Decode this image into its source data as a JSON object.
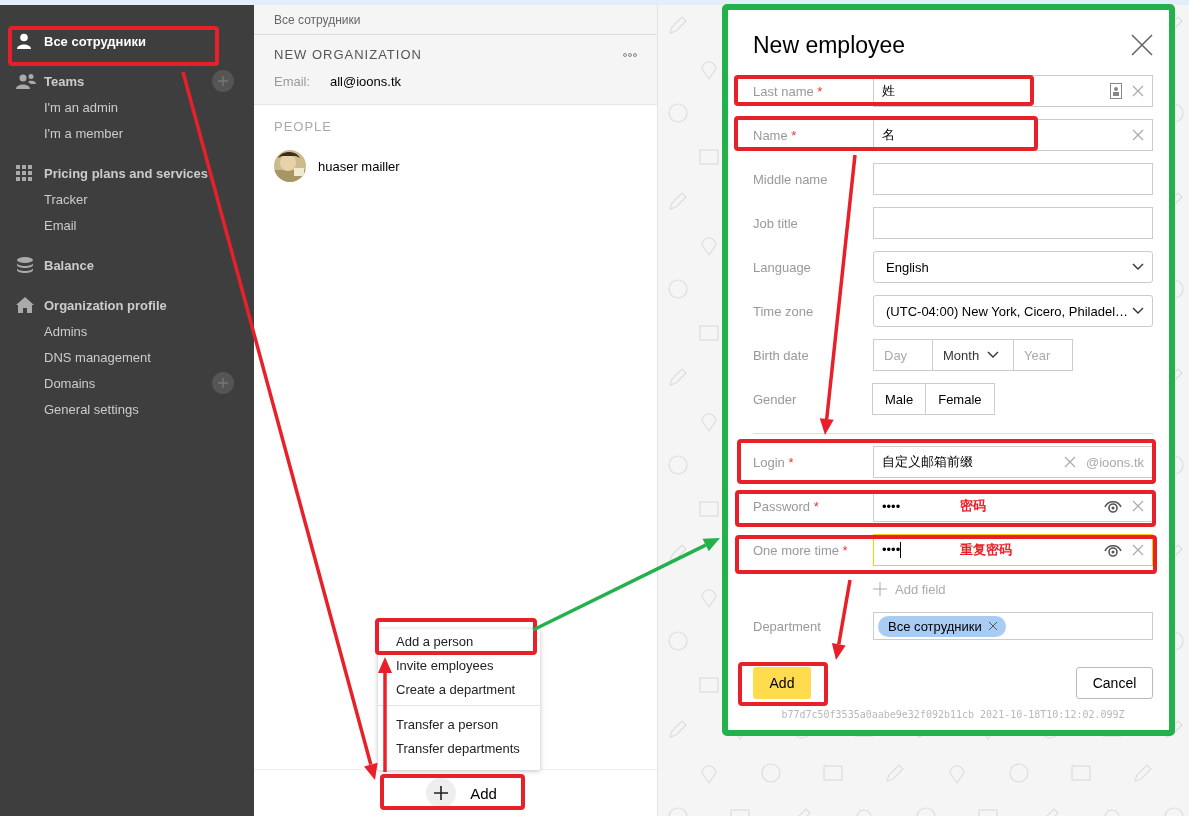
{
  "sidebar": {
    "sections": [
      {
        "label": "Все сотрудники",
        "selected": true,
        "addable": false
      },
      {
        "label": "Teams",
        "selected": false,
        "addable": true,
        "items": [
          {
            "label": "I'm an admin",
            "addable": false
          },
          {
            "label": "I'm a member",
            "addable": false
          }
        ]
      },
      {
        "label": "Pricing plans and services",
        "selected": false,
        "addable": false,
        "items": [
          {
            "label": "Tracker",
            "addable": false
          },
          {
            "label": "Email",
            "addable": false
          }
        ]
      },
      {
        "label": "Balance",
        "selected": false,
        "addable": false
      },
      {
        "label": "Organization profile",
        "selected": false,
        "addable": false,
        "items": [
          {
            "label": "Admins",
            "addable": false
          },
          {
            "label": "DNS management",
            "addable": false
          },
          {
            "label": "Domains",
            "addable": true
          },
          {
            "label": "General settings",
            "addable": false
          }
        ]
      }
    ]
  },
  "breadcrumb": "Все сотрудники",
  "organization": {
    "title": "NEW ORGANIZATION",
    "email_label": "Email:",
    "email": "all@ioons.tk"
  },
  "people": {
    "heading": "PEOPLE",
    "items": [
      {
        "name": "huaser mailler"
      }
    ]
  },
  "add_menu": {
    "groups": [
      [
        {
          "label": "Add a person"
        },
        {
          "label": "Invite employees"
        },
        {
          "label": "Create a department"
        }
      ],
      [
        {
          "label": "Transfer a person"
        },
        {
          "label": "Transfer departments"
        }
      ]
    ]
  },
  "add_button": "Add",
  "dialog": {
    "title": "New employee",
    "fields": [
      {
        "kind": "contact",
        "label": "Last name",
        "mark": "*",
        "value": "姓",
        "clearable": true
      },
      {
        "kind": "text",
        "label": "Name",
        "mark": "*",
        "value": "名",
        "clearable": true
      },
      {
        "kind": "text",
        "label": "Middle name",
        "clearable": false
      },
      {
        "kind": "text",
        "label": "Job title",
        "clearable": false
      },
      {
        "kind": "select",
        "label": "Language",
        "value": "English"
      },
      {
        "kind": "select",
        "label": "Time zone",
        "value": "(UTC-04:00) New York, Cicero, Philadel…"
      },
      {
        "kind": "date",
        "label": "Birth date",
        "day_placeholder": "Day",
        "month": "Month",
        "year_placeholder": "Year"
      },
      {
        "kind": "choice",
        "label": "Gender",
        "options": [
          {
            "label": "Male",
            "selected": false
          },
          {
            "label": "Female",
            "selected": false
          }
        ]
      },
      {
        "kind": "divider"
      },
      {
        "kind": "login",
        "label": "Login",
        "mark": "*",
        "value": "自定义邮箱前缀",
        "suffix": "@ioons.tk",
        "clearable": true
      },
      {
        "kind": "password",
        "label": "Password",
        "mark": "*",
        "value": "••••",
        "focused": false,
        "note": "密码",
        "clearable": true
      },
      {
        "kind": "password",
        "label": "One more time",
        "mark": "*",
        "value": "••••",
        "focused": true,
        "note": "重复密码",
        "clearable": true
      },
      {
        "kind": "add_field",
        "label": "Add field"
      },
      {
        "kind": "tags",
        "label": "Department",
        "tags": [
          {
            "label": "Все сотрудники"
          }
        ]
      }
    ],
    "submit": "Add",
    "cancel": "Cancel",
    "build_info": "b77d7c50f3535a0aabe9e32f092b11cb 2021-10-18T10:12:02.099Z"
  }
}
